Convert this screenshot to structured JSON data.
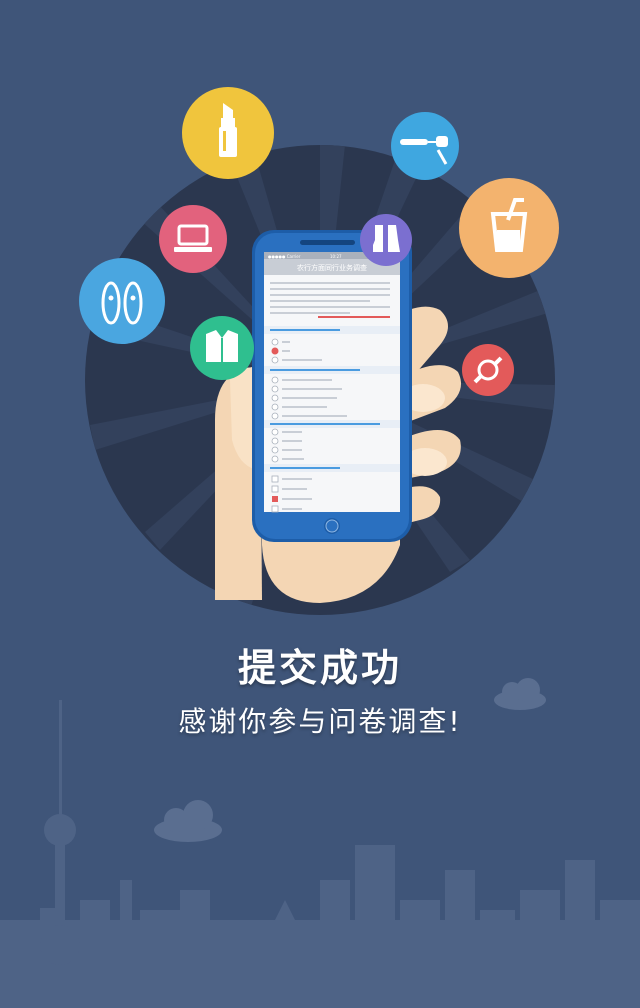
{
  "message": {
    "title": "提交成功",
    "subtitle": "感谢你参与问卷调查!"
  },
  "phone": {
    "status_carrier": "●●●●● Carrier",
    "status_time": "10:27",
    "screen_title": "农行方面同行业务调查",
    "icon_names": [
      "lipstick-icon",
      "mascara-icon",
      "cup-icon",
      "laptop-icon",
      "boots-icon",
      "shoes-icon",
      "jacket-icon",
      "watch-icon"
    ]
  },
  "colors": {
    "background": "#3f5579",
    "circle": "#2d3a55",
    "accent_blue": "#4a9be0"
  }
}
